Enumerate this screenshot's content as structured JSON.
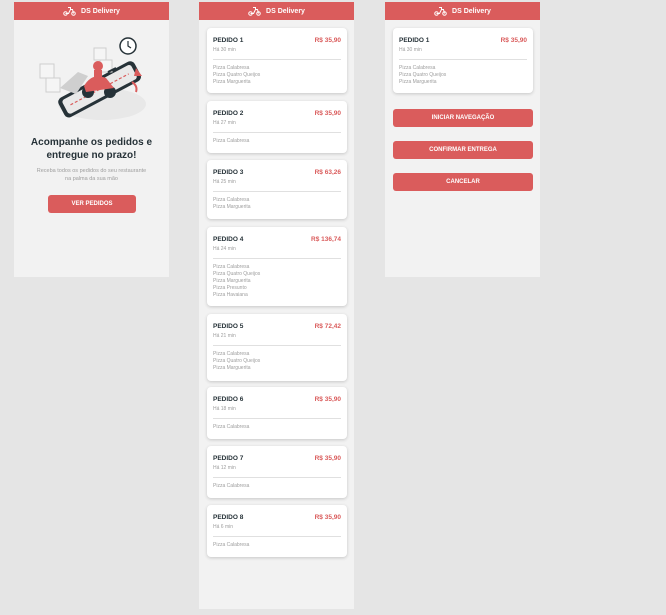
{
  "app": {
    "title": "DS Delivery",
    "accent": "#da5c5c"
  },
  "home": {
    "title": "Acompanhe os pedidos e entregue no prazo!",
    "subtitle": "Receba todos os pedidos do seu restaurante na palma da sua mão",
    "button": "VER PEDIDOS"
  },
  "orders": [
    {
      "label": "PEDIDO 1",
      "price": "R$ 35,90",
      "ago": "Há 30 min",
      "products": [
        "Pizza Calabresa",
        "Pizza Quatro Queijos",
        "Pizza Marguerita"
      ]
    },
    {
      "label": "PEDIDO 2",
      "price": "R$ 35,90",
      "ago": "Há 27 min",
      "products": [
        "Pizza Calabresa"
      ]
    },
    {
      "label": "PEDIDO 3",
      "price": "R$ 63,26",
      "ago": "Há 25 min",
      "products": [
        "Pizza Calabresa",
        "Pizza Marguerita"
      ]
    },
    {
      "label": "PEDIDO 4",
      "price": "R$ 136,74",
      "ago": "Há 24 min",
      "products": [
        "Pizza Calabresa",
        "Pizza Quatro Queijos",
        "Pizza Marguerita",
        "Pizza Presunto",
        "Pizza Havaiana"
      ]
    },
    {
      "label": "PEDIDO 5",
      "price": "R$ 72,42",
      "ago": "Há 21 min",
      "products": [
        "Pizza Calabresa",
        "Pizza Quatro Queijos",
        "Pizza Marguerita"
      ]
    },
    {
      "label": "PEDIDO 6",
      "price": "R$ 35,90",
      "ago": "Há 18 min",
      "products": [
        "Pizza Calabresa"
      ]
    },
    {
      "label": "PEDIDO 7",
      "price": "R$ 35,90",
      "ago": "Há 12 min",
      "products": [
        "Pizza Calabresa"
      ]
    },
    {
      "label": "PEDIDO 8",
      "price": "R$ 35,90",
      "ago": "Há 6 min",
      "products": [
        "Pizza Calabresa"
      ]
    }
  ],
  "details": {
    "order": {
      "label": "PEDIDO 1",
      "price": "R$ 35,90",
      "ago": "Há 30 min",
      "products": [
        "Pizza Calabresa",
        "Pizza Quatro Queijos",
        "Pizza Marguerita"
      ]
    },
    "buttons": {
      "navigate": "INICIAR NAVEGAÇÃO",
      "confirm": "CONFIRMAR ENTREGA",
      "cancel": "CANCELAR"
    }
  }
}
